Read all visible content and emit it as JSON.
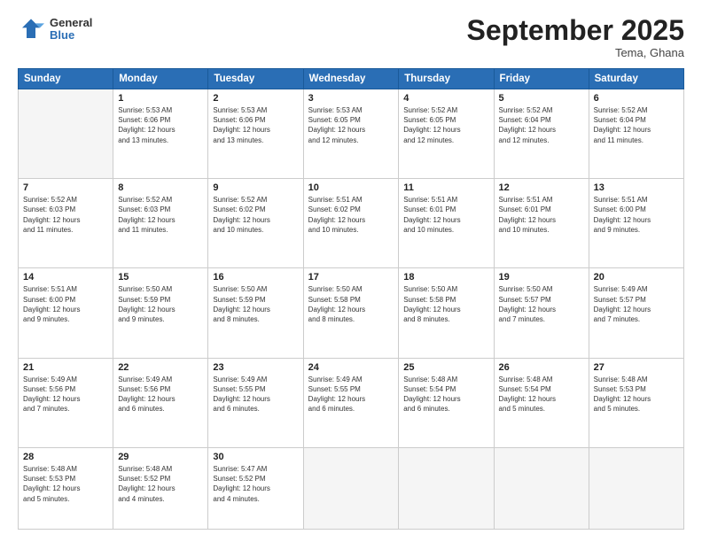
{
  "header": {
    "logo_general": "General",
    "logo_blue": "Blue",
    "title": "September 2025",
    "location": "Tema, Ghana"
  },
  "weekdays": [
    "Sunday",
    "Monday",
    "Tuesday",
    "Wednesday",
    "Thursday",
    "Friday",
    "Saturday"
  ],
  "weeks": [
    [
      {
        "num": "",
        "info": ""
      },
      {
        "num": "1",
        "info": "Sunrise: 5:53 AM\nSunset: 6:06 PM\nDaylight: 12 hours\nand 13 minutes."
      },
      {
        "num": "2",
        "info": "Sunrise: 5:53 AM\nSunset: 6:06 PM\nDaylight: 12 hours\nand 13 minutes."
      },
      {
        "num": "3",
        "info": "Sunrise: 5:53 AM\nSunset: 6:05 PM\nDaylight: 12 hours\nand 12 minutes."
      },
      {
        "num": "4",
        "info": "Sunrise: 5:52 AM\nSunset: 6:05 PM\nDaylight: 12 hours\nand 12 minutes."
      },
      {
        "num": "5",
        "info": "Sunrise: 5:52 AM\nSunset: 6:04 PM\nDaylight: 12 hours\nand 12 minutes."
      },
      {
        "num": "6",
        "info": "Sunrise: 5:52 AM\nSunset: 6:04 PM\nDaylight: 12 hours\nand 11 minutes."
      }
    ],
    [
      {
        "num": "7",
        "info": "Sunrise: 5:52 AM\nSunset: 6:03 PM\nDaylight: 12 hours\nand 11 minutes."
      },
      {
        "num": "8",
        "info": "Sunrise: 5:52 AM\nSunset: 6:03 PM\nDaylight: 12 hours\nand 11 minutes."
      },
      {
        "num": "9",
        "info": "Sunrise: 5:52 AM\nSunset: 6:02 PM\nDaylight: 12 hours\nand 10 minutes."
      },
      {
        "num": "10",
        "info": "Sunrise: 5:51 AM\nSunset: 6:02 PM\nDaylight: 12 hours\nand 10 minutes."
      },
      {
        "num": "11",
        "info": "Sunrise: 5:51 AM\nSunset: 6:01 PM\nDaylight: 12 hours\nand 10 minutes."
      },
      {
        "num": "12",
        "info": "Sunrise: 5:51 AM\nSunset: 6:01 PM\nDaylight: 12 hours\nand 10 minutes."
      },
      {
        "num": "13",
        "info": "Sunrise: 5:51 AM\nSunset: 6:00 PM\nDaylight: 12 hours\nand 9 minutes."
      }
    ],
    [
      {
        "num": "14",
        "info": "Sunrise: 5:51 AM\nSunset: 6:00 PM\nDaylight: 12 hours\nand 9 minutes."
      },
      {
        "num": "15",
        "info": "Sunrise: 5:50 AM\nSunset: 5:59 PM\nDaylight: 12 hours\nand 9 minutes."
      },
      {
        "num": "16",
        "info": "Sunrise: 5:50 AM\nSunset: 5:59 PM\nDaylight: 12 hours\nand 8 minutes."
      },
      {
        "num": "17",
        "info": "Sunrise: 5:50 AM\nSunset: 5:58 PM\nDaylight: 12 hours\nand 8 minutes."
      },
      {
        "num": "18",
        "info": "Sunrise: 5:50 AM\nSunset: 5:58 PM\nDaylight: 12 hours\nand 8 minutes."
      },
      {
        "num": "19",
        "info": "Sunrise: 5:50 AM\nSunset: 5:57 PM\nDaylight: 12 hours\nand 7 minutes."
      },
      {
        "num": "20",
        "info": "Sunrise: 5:49 AM\nSunset: 5:57 PM\nDaylight: 12 hours\nand 7 minutes."
      }
    ],
    [
      {
        "num": "21",
        "info": "Sunrise: 5:49 AM\nSunset: 5:56 PM\nDaylight: 12 hours\nand 7 minutes."
      },
      {
        "num": "22",
        "info": "Sunrise: 5:49 AM\nSunset: 5:56 PM\nDaylight: 12 hours\nand 6 minutes."
      },
      {
        "num": "23",
        "info": "Sunrise: 5:49 AM\nSunset: 5:55 PM\nDaylight: 12 hours\nand 6 minutes."
      },
      {
        "num": "24",
        "info": "Sunrise: 5:49 AM\nSunset: 5:55 PM\nDaylight: 12 hours\nand 6 minutes."
      },
      {
        "num": "25",
        "info": "Sunrise: 5:48 AM\nSunset: 5:54 PM\nDaylight: 12 hours\nand 6 minutes."
      },
      {
        "num": "26",
        "info": "Sunrise: 5:48 AM\nSunset: 5:54 PM\nDaylight: 12 hours\nand 5 minutes."
      },
      {
        "num": "27",
        "info": "Sunrise: 5:48 AM\nSunset: 5:53 PM\nDaylight: 12 hours\nand 5 minutes."
      }
    ],
    [
      {
        "num": "28",
        "info": "Sunrise: 5:48 AM\nSunset: 5:53 PM\nDaylight: 12 hours\nand 5 minutes."
      },
      {
        "num": "29",
        "info": "Sunrise: 5:48 AM\nSunset: 5:52 PM\nDaylight: 12 hours\nand 4 minutes."
      },
      {
        "num": "30",
        "info": "Sunrise: 5:47 AM\nSunset: 5:52 PM\nDaylight: 12 hours\nand 4 minutes."
      },
      {
        "num": "",
        "info": ""
      },
      {
        "num": "",
        "info": ""
      },
      {
        "num": "",
        "info": ""
      },
      {
        "num": "",
        "info": ""
      }
    ]
  ]
}
